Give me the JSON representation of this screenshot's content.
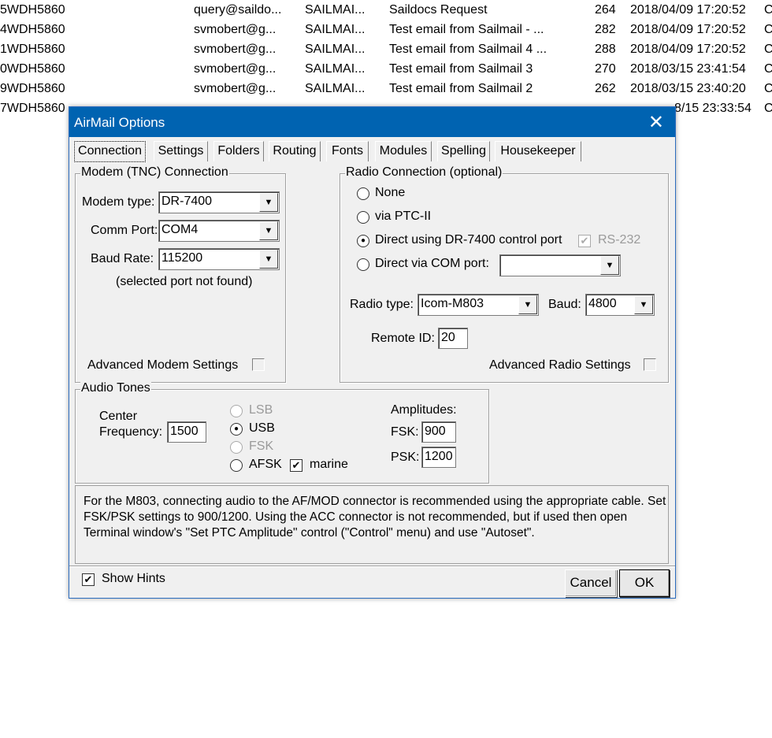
{
  "background_rows": [
    {
      "id": "5WDH5860",
      "from": "query@saildo...",
      "to": "SAILMAI...",
      "subject": "Saildocs Request",
      "size": "264",
      "date": "2018/04/09 17:20:52",
      "x": "C"
    },
    {
      "id": "4WDH5860",
      "from": "svmobert@g...",
      "to": "SAILMAI...",
      "subject": "Test email from Sailmail - ...",
      "size": "282",
      "date": "2018/04/09 17:20:52",
      "x": "C"
    },
    {
      "id": "1WDH5860",
      "from": "svmobert@g...",
      "to": "SAILMAI...",
      "subject": "Test email from Sailmail 4 ...",
      "size": "288",
      "date": "2018/04/09 17:20:52",
      "x": "C"
    },
    {
      "id": "0WDH5860",
      "from": "svmobert@g...",
      "to": "SAILMAI...",
      "subject": "Test email from Sailmail 3",
      "size": "270",
      "date": "2018/03/15 23:41:54",
      "x": "C"
    },
    {
      "id": "9WDH5860",
      "from": "svmobert@g...",
      "to": "SAILMAI...",
      "subject": "Test email from Sailmail 2",
      "size": "262",
      "date": "2018/03/15 23:40:20",
      "x": "C"
    },
    {
      "id": "7WDH5860",
      "from": "",
      "to": "",
      "subject": "",
      "size": "",
      "date": "8/15 23:33:54",
      "x": "C"
    }
  ],
  "dialog": {
    "title": "AirMail Options",
    "close_glyph": "✕",
    "tabs": [
      "Connection",
      "Settings",
      "Folders",
      "Routing",
      "Fonts",
      "Modules",
      "Spelling",
      "Housekeeper"
    ],
    "modem": {
      "group_label": "Modem (TNC) Connection",
      "modem_type_label": "Modem type:",
      "modem_type_value": "DR-7400",
      "comm_port_label": "Comm Port:",
      "comm_port_value": "COM4",
      "baud_rate_label": "Baud Rate:",
      "baud_rate_value": "115200",
      "status": "(selected port not found)",
      "advanced_label": "Advanced Modem Settings"
    },
    "radio": {
      "group_label": "Radio Connection (optional)",
      "options": [
        "None",
        "via PTC-II",
        "Direct using DR-7400 control port",
        "Direct via COM port:"
      ],
      "selected_option": "Direct using DR-7400 control port",
      "rs232_label": "RS-232",
      "com_port_value": "",
      "radio_type_label": "Radio type:",
      "radio_type_value": "Icom-M803",
      "baud_label": "Baud:",
      "baud_value": "4800",
      "remote_id_label": "Remote ID:",
      "remote_id_value": "20",
      "advanced_label": "Advanced Radio Settings"
    },
    "audio": {
      "group_label": "Audio Tones",
      "center_label_1": "Center",
      "center_label_2": "Frequency:",
      "center_value": "1500",
      "modes": [
        "LSB",
        "USB",
        "FSK",
        "AFSK"
      ],
      "selected_mode": "USB",
      "marine_label": "marine",
      "marine_checked": true,
      "amplitudes_label": "Amplitudes:",
      "fsk_label": "FSK:",
      "fsk_value": "900",
      "psk_label": "PSK:",
      "psk_value": "1200"
    },
    "hint_text": "For the M803, connecting audio to the AF/MOD connector is recommended using the appropriate cable. Set FSK/PSK settings to 900/1200. Using the ACC connector is not recommended, but if used then open Terminal window's \"Set PTC Amplitude\" control (\"Control\" menu) and use \"Autoset\".",
    "show_hints_label": "Show Hints",
    "show_hints_checked": true,
    "cancel_label": "Cancel",
    "ok_label": "OK"
  }
}
